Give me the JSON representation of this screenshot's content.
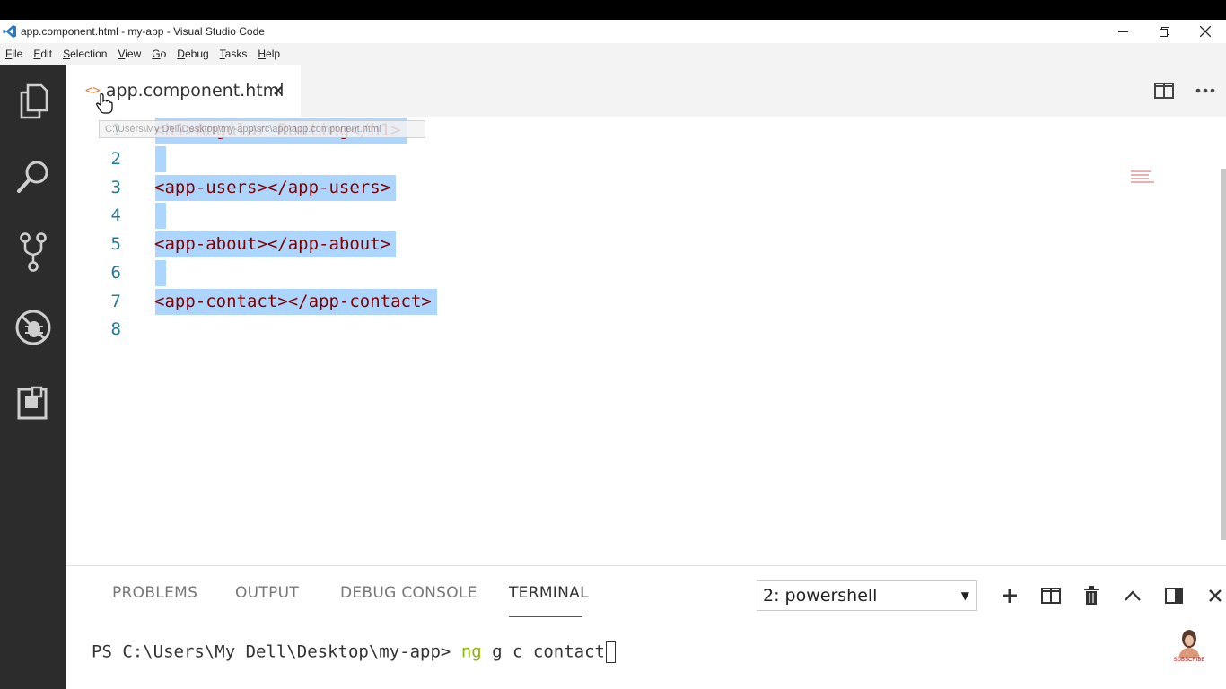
{
  "window": {
    "title": "app.component.html - my-app - Visual Studio Code",
    "controls": [
      "minimize",
      "restore",
      "close"
    ]
  },
  "menu": [
    {
      "label": "File",
      "accel": "F",
      "rest": "ile"
    },
    {
      "label": "Edit",
      "accel": "E",
      "rest": "dit"
    },
    {
      "label": "Selection",
      "accel": "S",
      "rest": "election"
    },
    {
      "label": "View",
      "accel": "V",
      "rest": "iew"
    },
    {
      "label": "Go",
      "accel": "G",
      "rest": "o"
    },
    {
      "label": "Debug",
      "accel": "D",
      "rest": "ebug"
    },
    {
      "label": "Tasks",
      "accel": "T",
      "rest": "asks"
    },
    {
      "label": "Help",
      "accel": "H",
      "rest": "elp"
    }
  ],
  "activity_bar": [
    "explorer-icon",
    "search-icon",
    "source-control-icon",
    "debug-icon",
    "extensions-icon"
  ],
  "tab": {
    "label": "app.component.html",
    "icon": "<>",
    "close": "×"
  },
  "hover_tooltip": "C:\\Users\\My Dell\\Desktop\\my-app\\src\\app\\app.component.html",
  "editor": {
    "lines": [
      {
        "n": "1",
        "text": "<h1>Angular Routing</h1>"
      },
      {
        "n": "2",
        "text": ""
      },
      {
        "n": "3",
        "text": "<app-users></app-users>"
      },
      {
        "n": "4",
        "text": ""
      },
      {
        "n": "5",
        "text": "<app-about></app-about>"
      },
      {
        "n": "6",
        "text": ""
      },
      {
        "n": "7",
        "text": "<app-contact></app-contact>"
      },
      {
        "n": "8",
        "text": ""
      }
    ],
    "text_color": "#800000",
    "selection_color": "#add6ff"
  },
  "panel": {
    "tabs": [
      "PROBLEMS",
      "OUTPUT",
      "DEBUG CONSOLE",
      "TERMINAL"
    ],
    "active_tab": "TERMINAL",
    "terminal_select": "2: powershell",
    "terminal": {
      "prompt": "PS C:\\Users\\My Dell\\Desktop\\my-app> ",
      "cmd": "ng",
      "args": " g c contact"
    }
  },
  "watermark": {
    "label": "SUBSCRIBE"
  }
}
